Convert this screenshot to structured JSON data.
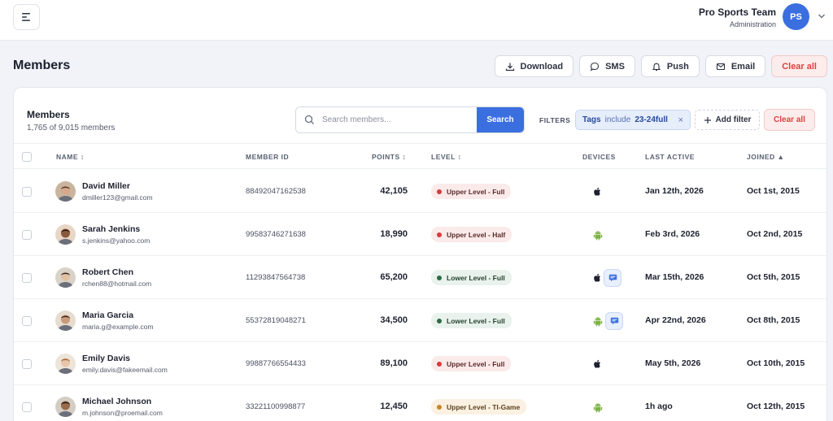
{
  "header": {
    "org_name": "Pro Sports Team",
    "org_role": "Administration",
    "avatar_initials": "PS"
  },
  "page": {
    "title": "Members",
    "actions": [
      "Download",
      "SMS",
      "Push",
      "Email",
      "Clear all"
    ]
  },
  "card": {
    "title": "Members",
    "subtitle": "1,765 of 9,015 members",
    "search_placeholder": "Search members...",
    "search_button": "Search",
    "filters_label": "FILTERS",
    "filter_chip": {
      "key": "Tags",
      "op": "include",
      "value": "23-24full",
      "remove": "×"
    },
    "add_filter": "Add filter",
    "clear_all": "Clear all"
  },
  "columns": {
    "name": "NAME",
    "member_id": "MEMBER ID",
    "points": "POINTS",
    "level": "LEVEL",
    "devices": "DEVICES",
    "last_active": "LAST ACTIVE",
    "joined": "JOINED"
  },
  "members": [
    {
      "name": "David Miller",
      "email": "dmiller123@gmail.com",
      "id": "88492047162538",
      "points": "42,105",
      "level": "Upper Level - Full",
      "level_color": "red",
      "devices": [
        "apple"
      ],
      "last_active": "Jan 12th, 2026",
      "joined": "Oct 1st, 2015"
    },
    {
      "name": "Sarah Jenkins",
      "email": "s.jenkins@yahoo.com",
      "id": "99583746271638",
      "points": "18,990",
      "level": "Upper Level - Half",
      "level_color": "red",
      "devices": [
        "android"
      ],
      "last_active": "Feb 3rd, 2026",
      "joined": "Oct 2nd, 2015"
    },
    {
      "name": "Robert Chen",
      "email": "rchen88@hotmail.com",
      "id": "11293847564738",
      "points": "65,200",
      "level": "Lower Level - Full",
      "level_color": "green",
      "devices": [
        "apple",
        "sms"
      ],
      "last_active": "Mar 15th, 2026",
      "joined": "Oct 5th, 2015"
    },
    {
      "name": "Maria Garcia",
      "email": "maria.g@example.com",
      "id": "55372819048271",
      "points": "34,500",
      "level": "Lower Level - Full",
      "level_color": "green",
      "devices": [
        "android",
        "sms"
      ],
      "last_active": "Apr 22nd, 2026",
      "joined": "Oct 8th, 2015"
    },
    {
      "name": "Emily Davis",
      "email": "emily.davis@fakeemail.com",
      "id": "99887766554433",
      "points": "89,100",
      "level": "Upper Level - Full",
      "level_color": "red",
      "devices": [
        "apple"
      ],
      "last_active": "May 5th, 2026",
      "joined": "Oct 10th, 2015"
    },
    {
      "name": "Michael Johnson",
      "email": "m.johnson@proemail.com",
      "id": "33221100998877",
      "points": "12,450",
      "level": "Upper Level - TI-Game",
      "level_color": "orange",
      "devices": [
        "android"
      ],
      "last_active": "1h ago",
      "joined": "Oct 12th, 2015"
    }
  ],
  "colors": {
    "accent": "#3b6fe0",
    "danger": "#e0413e",
    "android": "#7cb342"
  }
}
